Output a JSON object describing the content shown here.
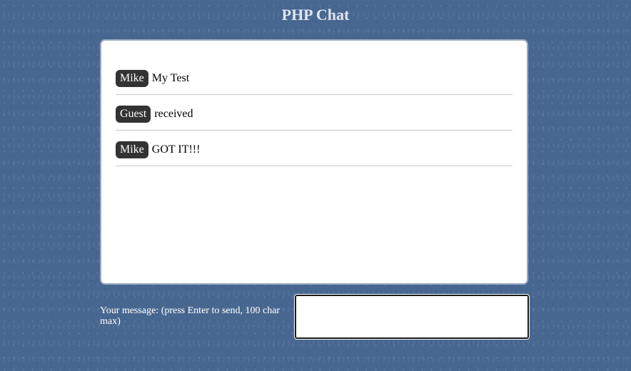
{
  "app": {
    "title": "PHP Chat"
  },
  "chat": {
    "messages": [
      {
        "user": "Mike",
        "text": "My Test"
      },
      {
        "user": "Guest",
        "text": "received"
      },
      {
        "user": "Mike",
        "text": "GOT IT!!!"
      }
    ]
  },
  "composer": {
    "label": "Your message: (press Enter to send, 100 char max)",
    "value": ""
  },
  "colors": {
    "background": "#476790",
    "username_badge": "#333333",
    "chat_box": "#ffffff"
  }
}
